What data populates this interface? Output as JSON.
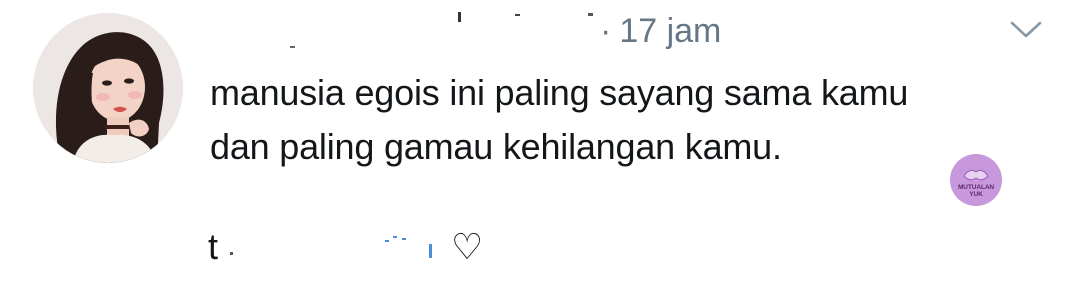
{
  "tweet": {
    "timestamp": "17 jam",
    "separator": "·",
    "text_line_1": "manusia egois ini paling sayang sama kamu",
    "text_line_2": "dan paling gamau kehilangan kamu.",
    "sign_prefix": "t",
    "sign_heart": "♡"
  },
  "watermark": {
    "line_1": "MUTUALAN",
    "line_2": "YUK"
  },
  "icons": {
    "caret": "chevron-down-icon"
  },
  "colors": {
    "text": "#14171a",
    "muted": "#657786",
    "watermark_bg": "#c898dc"
  }
}
